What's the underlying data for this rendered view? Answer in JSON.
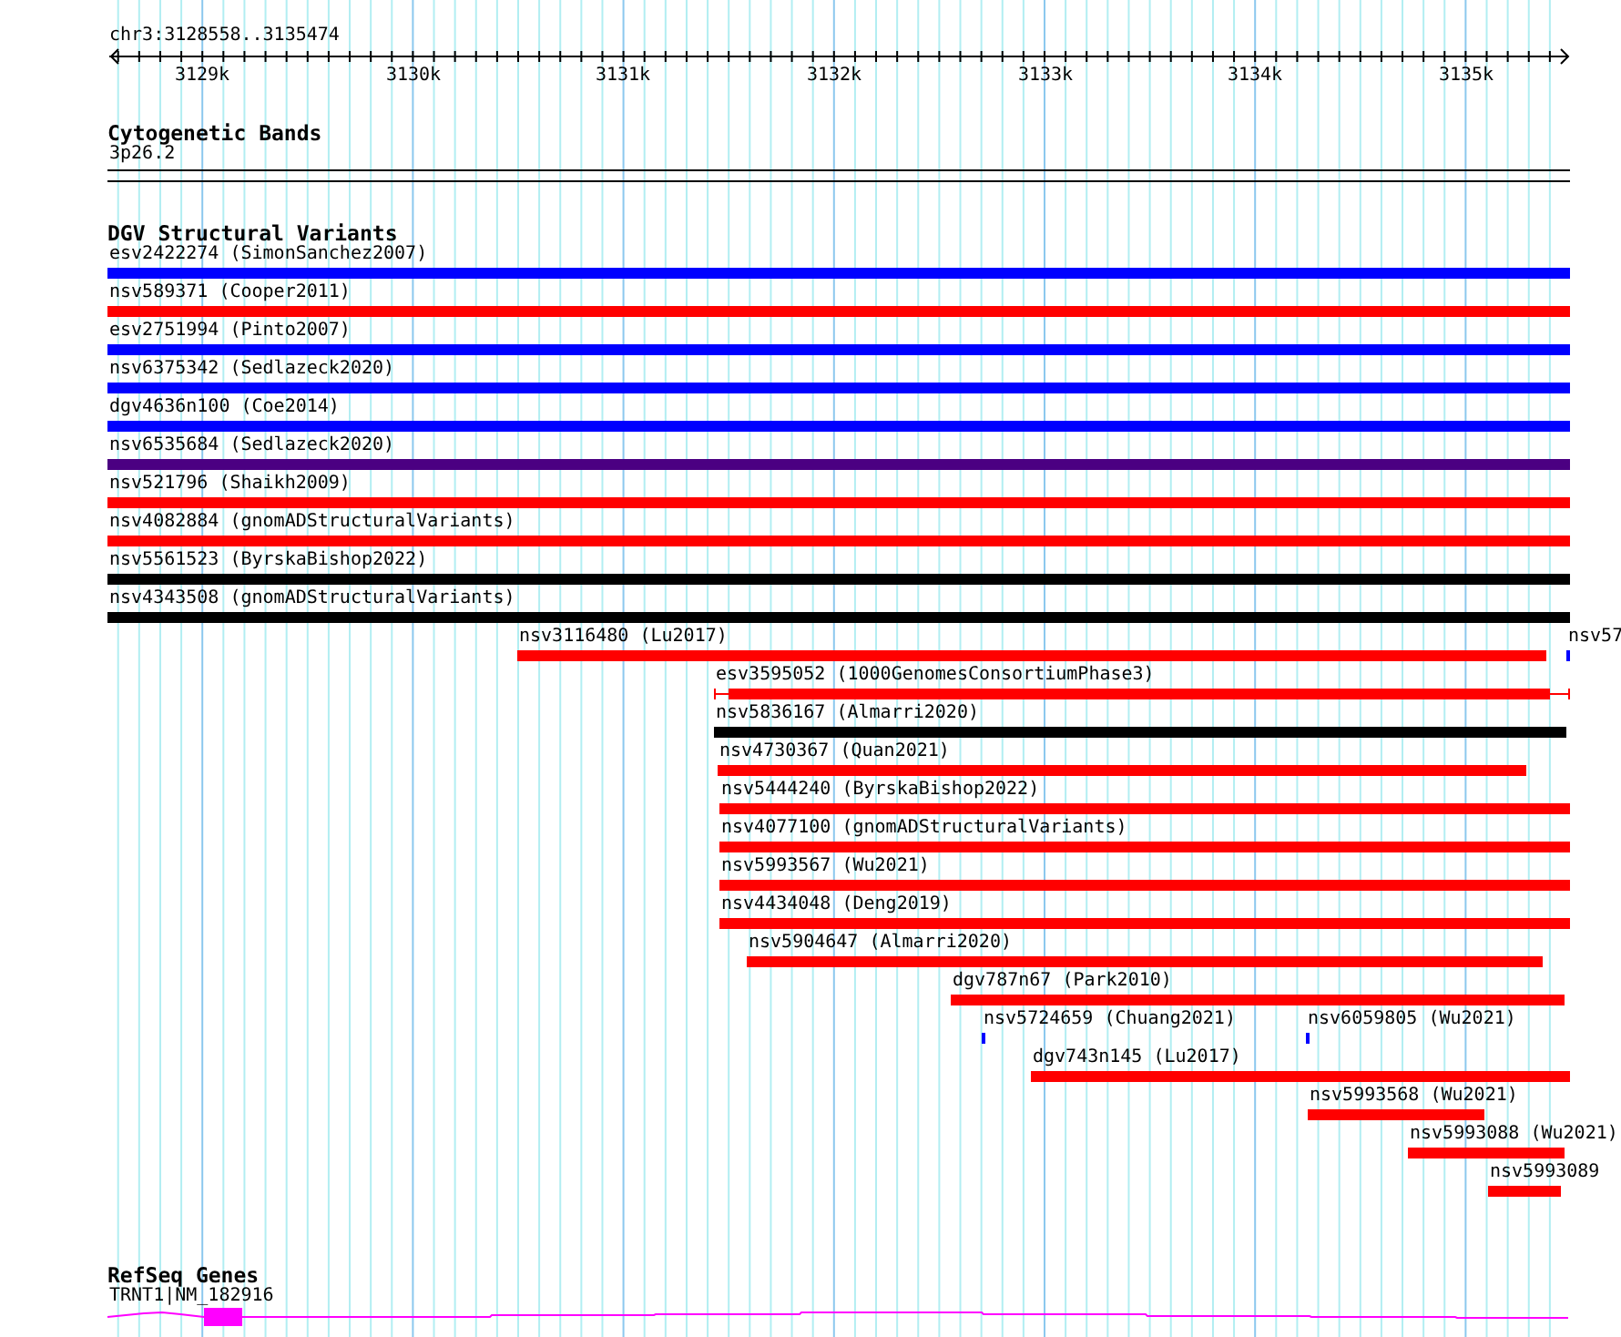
{
  "ruler": {
    "location": "chr3:3128558..3135474",
    "ticks": [
      "3129k",
      "3130k",
      "3131k",
      "3132k",
      "3133k",
      "3134k",
      "3135k"
    ]
  },
  "tracks": [
    {
      "kind": "bands",
      "title": "Cytogenetic Bands",
      "features": [
        {
          "label": "3p26.2"
        }
      ]
    },
    {
      "kind": "variants",
      "title": "DGV Structural Variants",
      "rows": [
        {
          "features": [
            {
              "kind": "block",
              "label": "esv2422274 (SimonSanchez2007)",
              "color": "#0000ff"
            }
          ]
        },
        {
          "features": [
            {
              "kind": "block",
              "label": "nsv589371 (Cooper2011)",
              "color": "#ff0000"
            }
          ]
        },
        {
          "features": [
            {
              "kind": "block",
              "label": "esv2751994 (Pinto2007)",
              "color": "#0000ff"
            }
          ]
        },
        {
          "features": [
            {
              "kind": "block",
              "label": "nsv6375342 (Sedlazeck2020)",
              "color": "#0000ff"
            }
          ]
        },
        {
          "features": [
            {
              "kind": "block",
              "label": "dgv4636n100 (Coe2014)",
              "color": "#0000ff"
            }
          ]
        },
        {
          "features": [
            {
              "kind": "block",
              "label": "nsv6535684 (Sedlazeck2020)",
              "color": "#4b0082"
            }
          ]
        },
        {
          "features": [
            {
              "kind": "block",
              "label": "nsv521796 (Shaikh2009)",
              "color": "#ff0000"
            }
          ]
        },
        {
          "features": [
            {
              "kind": "block",
              "label": "nsv4082884 (gnomADStructuralVariants)",
              "color": "#ff0000"
            }
          ]
        },
        {
          "features": [
            {
              "kind": "block",
              "label": "nsv5561523 (ByrskaBishop2022)",
              "color": "#000000"
            }
          ]
        },
        {
          "features": [
            {
              "kind": "block",
              "label": "nsv4343508 (gnomADStructuralVariants)",
              "color": "#000000"
            }
          ]
        },
        {
          "features": [
            {
              "kind": "block",
              "label": "nsv3116480 (Lu2017)",
              "color": "#ff0000"
            },
            {
              "kind": "block",
              "label": "nsv57",
              "color": "#0000ff"
            }
          ]
        },
        {
          "features": [
            {
              "kind": "range",
              "label": "esv3595052 (1000GenomesConsortiumPhase3)",
              "color": "#ff0000"
            }
          ]
        },
        {
          "features": [
            {
              "kind": "block",
              "label": "nsv5836167 (Almarri2020)",
              "color": "#000000"
            }
          ]
        },
        {
          "features": [
            {
              "kind": "block",
              "label": "nsv4730367 (Quan2021)",
              "color": "#ff0000"
            }
          ]
        },
        {
          "features": [
            {
              "kind": "block",
              "label": "nsv5444240 (ByrskaBishop2022)",
              "color": "#ff0000"
            }
          ]
        },
        {
          "features": [
            {
              "kind": "block",
              "label": "nsv4077100 (gnomADStructuralVariants)",
              "color": "#ff0000"
            }
          ]
        },
        {
          "features": [
            {
              "kind": "block",
              "label": "nsv5993567 (Wu2021)",
              "color": "#ff0000"
            }
          ]
        },
        {
          "features": [
            {
              "kind": "block",
              "label": "nsv4434048 (Deng2019)",
              "color": "#ff0000"
            }
          ]
        },
        {
          "features": [
            {
              "kind": "block",
              "label": "nsv5904647 (Almarri2020)",
              "color": "#ff0000"
            }
          ]
        },
        {
          "features": [
            {
              "kind": "block",
              "label": "dgv787n67 (Park2010)",
              "color": "#ff0000"
            }
          ]
        },
        {
          "features": [
            {
              "kind": "block",
              "label": "nsv5724659 (Chuang2021)",
              "color": "#0000ff"
            },
            {
              "kind": "block",
              "label": "nsv6059805 (Wu2021)",
              "color": "#0000ff"
            }
          ]
        },
        {
          "features": [
            {
              "kind": "block",
              "label": "dgv743n145 (Lu2017)",
              "color": "#ff0000"
            }
          ]
        },
        {
          "features": [
            {
              "kind": "block",
              "label": "nsv5993568 (Wu2021)",
              "color": "#ff0000"
            }
          ]
        },
        {
          "features": [
            {
              "kind": "block",
              "label": "nsv5993088 (Wu2021)",
              "color": "#ff0000"
            }
          ]
        },
        {
          "features": [
            {
              "kind": "block",
              "label": "nsv5993089",
              "color": "#ff0000"
            }
          ]
        }
      ]
    },
    {
      "kind": "genes",
      "title": "RefSeq Genes",
      "features": [
        {
          "label": "TRNT1|NM_182916",
          "color": "#ff00ff"
        }
      ]
    }
  ]
}
